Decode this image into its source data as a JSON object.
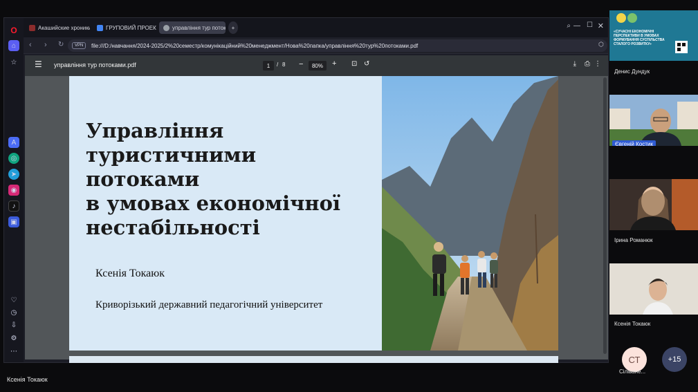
{
  "browser": {
    "tabs": [
      {
        "label": "Акашийские хроники ку",
        "color": "#8b2c2c"
      },
      {
        "label": "ГРУПОВИЙ ПРОЕКТ під",
        "color": "#4285f4"
      },
      {
        "label": "управління тур потокам",
        "color": "#6b7280"
      }
    ],
    "vpn": "VPN",
    "url": "file:///D:/навчання/2024-2025/2%20семестр/комунікаційний%20менеджмент/Нова%20папка/управління%20тур%20потоками.pdf"
  },
  "pdf": {
    "filename": "управління тур потоками.pdf",
    "page": "1",
    "total_pages": "8",
    "zoom": "80%"
  },
  "slide": {
    "title_lines": [
      "Управління",
      "туристичними потоками",
      "в умовах економічної",
      "нестабільності"
    ],
    "author": "Ксенія Токаюк",
    "university": "Криворізький державний педагогічний університет"
  },
  "participants": [
    {
      "name": "Денис Дундук"
    },
    {
      "name": "Євгеній Костик"
    },
    {
      "name": "Ірина Романюк"
    },
    {
      "name": "Ксенія Токаюк"
    }
  ],
  "avatar": {
    "initials": "СТ",
    "name": "Сіліване...",
    "more": "+15"
  },
  "poster_text": [
    "«СУЧАСНІ ЕКОНОМІЧНІ",
    "ПЕРСПЕКТИВИ В УМОВАХ",
    "ФОРМУВАННЯ СУСПІЛЬСТВА",
    "СТАЛОГО РОЗВИТКУ»"
  ],
  "presenter_label": "Ксенія Токаюк"
}
